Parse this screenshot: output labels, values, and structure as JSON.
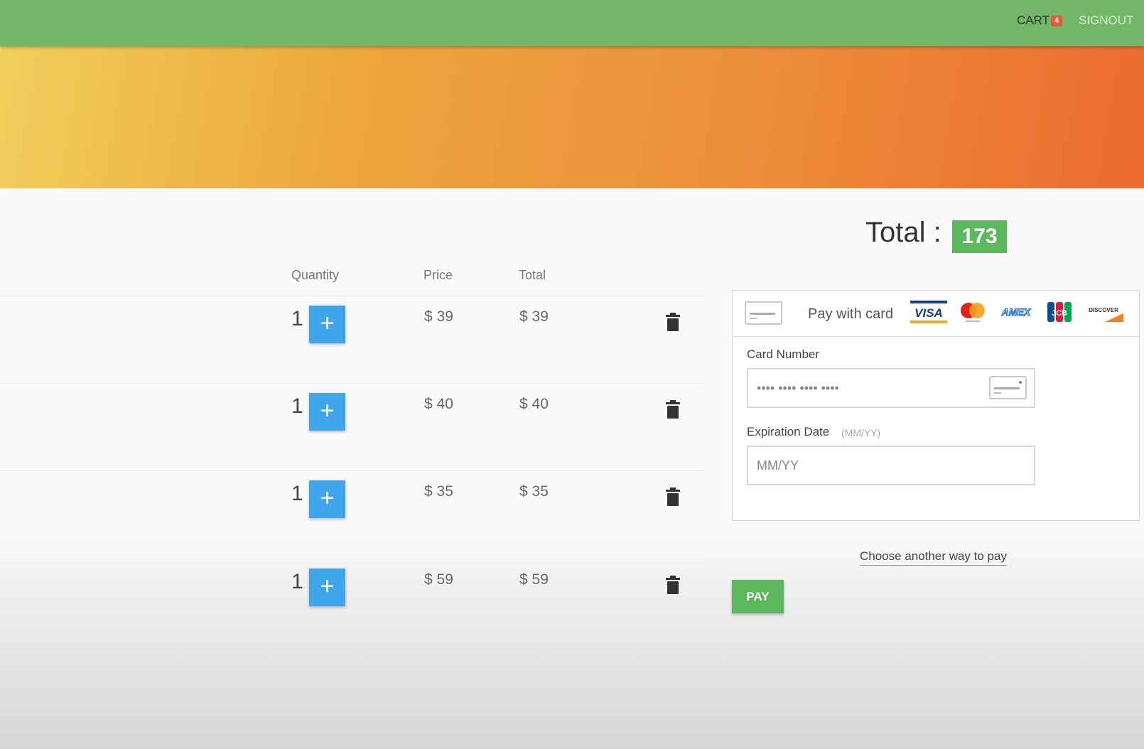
{
  "nav": {
    "cart_label": "CART",
    "cart_count": "4",
    "signout_label": "SIGNOUT"
  },
  "colors": {
    "navbar": "#72b768",
    "accent_green": "#5cb85c",
    "plus_button": "#3fa6ec",
    "badge": "#e85a3a"
  },
  "summary": {
    "total_label": "Total :",
    "total_value": "173"
  },
  "table": {
    "headers": {
      "quantity": "Quantity",
      "price": "Price",
      "total": "Total"
    },
    "rows": [
      {
        "quantity": "1",
        "plus": "+",
        "price": "$ 39",
        "total": "$ 39"
      },
      {
        "quantity": "1",
        "plus": "+",
        "price": "$ 40",
        "total": "$ 40"
      },
      {
        "quantity": "1",
        "plus": "+",
        "price": "$ 35",
        "total": "$ 35"
      },
      {
        "quantity": "1",
        "plus": "+",
        "price": "$ 59",
        "total": "$ 59"
      }
    ]
  },
  "payment": {
    "pay_with_card": "Pay with card",
    "brands": [
      "VISA",
      "mastercard",
      "AMEX",
      "JCB",
      "DISCOVER"
    ],
    "card_number_label": "Card Number",
    "card_number_placeholder": "•••• •••• •••• ••••",
    "expiration_label": "Expiration Date",
    "expiration_hint": "(MM/YY)",
    "expiration_placeholder": "MM/YY",
    "choose_another": "Choose another way to pay",
    "pay_button": "PAY"
  }
}
